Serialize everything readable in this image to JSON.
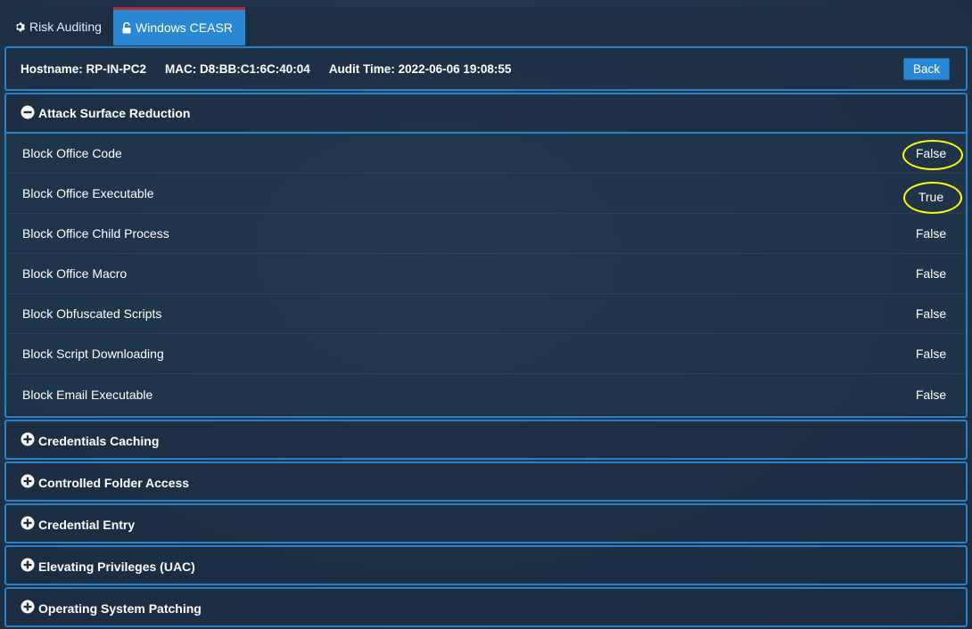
{
  "tabs": [
    {
      "label": "Risk Auditing",
      "icon": "gear-icon",
      "active": false
    },
    {
      "label": "Windows CEASR",
      "icon": "unlock-icon",
      "active": true
    }
  ],
  "info": {
    "hostname": "Hostname: RP-IN-PC2",
    "mac": "MAC: D8:BB:C1:6C:40:04",
    "audit_time": "Audit Time: 2022-06-06 19:08:55",
    "back_label": "Back"
  },
  "sections": {
    "asr": {
      "title": "Attack Surface Reduction",
      "expanded": true,
      "rows": [
        {
          "label": "Block Office Code",
          "value": "False",
          "highlighted": true
        },
        {
          "label": "Block Office Executable",
          "value": "True",
          "highlighted": true
        },
        {
          "label": "Block Office Child Process",
          "value": "False"
        },
        {
          "label": "Block Office Macro",
          "value": "False"
        },
        {
          "label": "Block Obfuscated Scripts",
          "value": "False"
        },
        {
          "label": "Block Script Downloading",
          "value": "False"
        },
        {
          "label": "Block Email Executable",
          "value": "False"
        }
      ]
    },
    "collapsed": [
      {
        "title": "Credentials Caching"
      },
      {
        "title": "Controlled Folder Access"
      },
      {
        "title": "Credential Entry"
      },
      {
        "title": "Elevating Privileges (UAC)"
      },
      {
        "title": "Operating System Patching"
      }
    ]
  },
  "colors": {
    "accent": "#2a87d3",
    "active_tab_top": "#c0272d",
    "annotation": "#ffff00"
  }
}
